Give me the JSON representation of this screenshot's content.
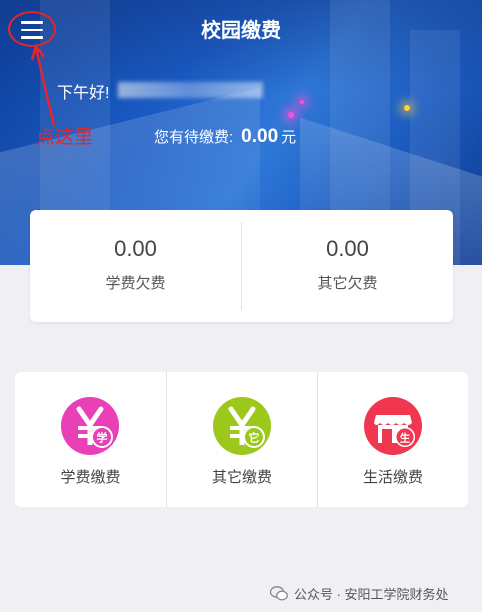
{
  "header": {
    "title": "校园缴费",
    "greeting": "下午好!",
    "pending_label": "您有待缴费:",
    "pending_amount": "0.00",
    "pending_unit": "元"
  },
  "annotation": {
    "text": "点这里",
    "color": "#e8242a"
  },
  "arrears": [
    {
      "value": "0.00",
      "label": "学费欠费"
    },
    {
      "value": "0.00",
      "label": "其它欠费"
    }
  ],
  "payments": [
    {
      "label": "学费缴费",
      "icon": "yen-study-icon",
      "badge": "学",
      "color": "#e93fb7"
    },
    {
      "label": "其它缴费",
      "icon": "yen-other-icon",
      "badge": "它",
      "color": "#9cc81c"
    },
    {
      "label": "生活缴费",
      "icon": "shop-life-icon",
      "badge": "生",
      "color": "#f0374f"
    }
  ],
  "footer": {
    "text": "公众号 · 安阳工学院财务处"
  }
}
